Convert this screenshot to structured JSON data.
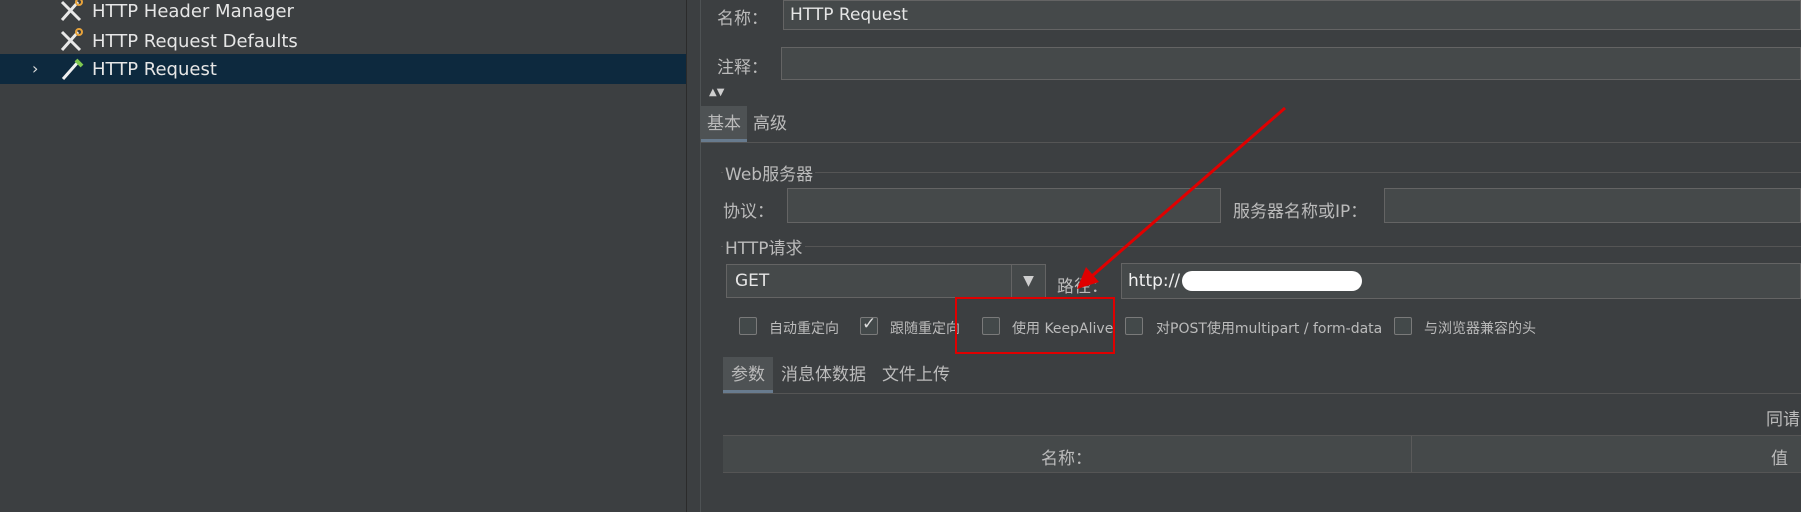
{
  "tree": {
    "items": [
      {
        "label": "HTTP Header Manager",
        "icon": "wrench-scissors-icon"
      },
      {
        "label": "HTTP Request Defaults",
        "icon": "wrench-scissors-icon"
      },
      {
        "label": "HTTP Request",
        "icon": "pipette-icon",
        "selected": true,
        "expander": "›"
      }
    ]
  },
  "form": {
    "name_label": "名称：",
    "name_value": "HTTP Request",
    "comment_label": "注释：",
    "comment_value": "",
    "collapse_arrows": "▲▼",
    "tabs": [
      "基本",
      "高级"
    ],
    "web_server": {
      "title": "Web服务器",
      "protocol_label": "协议：",
      "protocol_value": "",
      "server_label": "服务器名称或IP：",
      "server_value": ""
    },
    "http_request": {
      "title": "HTTP请求",
      "method": "GET",
      "path_label": "路径：",
      "path_value": "http://"
    },
    "options": [
      {
        "label": "自动重定向",
        "checked": false
      },
      {
        "label": "跟随重定向",
        "checked": true
      },
      {
        "label": "使用 KeepAlive",
        "checked": false
      },
      {
        "label": "对POST使用multipart / form-data",
        "checked": false
      },
      {
        "label": "与浏览器兼容的头",
        "checked": false
      }
    ],
    "subtabs": [
      "参数",
      "消息体数据",
      "文件上传"
    ],
    "send_with_request": "同请",
    "table_headers": [
      "名称：",
      "值"
    ]
  },
  "colors": {
    "background": "#3c3f41",
    "selection": "#0d293e",
    "annotation": "#e00000"
  }
}
